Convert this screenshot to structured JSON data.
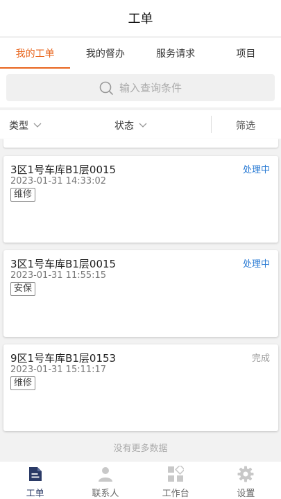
{
  "header": {
    "title": "工单"
  },
  "tabs": [
    {
      "label": "我的工单",
      "active": true
    },
    {
      "label": "我的督办",
      "active": false
    },
    {
      "label": "服务请求",
      "active": false
    },
    {
      "label": "项目",
      "active": false
    }
  ],
  "search": {
    "placeholder": "输入查询条件",
    "icon": "search-icon"
  },
  "filters": {
    "type_label": "类型",
    "status_label": "状态",
    "screen_label": "筛选"
  },
  "orders": [
    {
      "title": "3区1号车库B1层0015",
      "status": "处理中",
      "status_color": "#2a7bd4",
      "time": "2023-01-31 14:33:02",
      "tag": "维修"
    },
    {
      "title": "3区1号车库B1层0015",
      "status": "处理中",
      "status_color": "#2a7bd4",
      "time": "2023-01-31 11:55:15",
      "tag": "安保"
    },
    {
      "title": "9区1号车库B1层0153",
      "status": "完成",
      "status_color": "#999999",
      "time": "2023-01-31 15:11:17",
      "tag": "维修"
    }
  ],
  "list_footer": "没有更多数据",
  "tabbar": {
    "items": [
      {
        "label": "工单",
        "icon": "document-icon",
        "active": true
      },
      {
        "label": "联系人",
        "icon": "person-icon",
        "active": false
      },
      {
        "label": "工作台",
        "icon": "grid-icon",
        "active": false
      },
      {
        "label": "设置",
        "icon": "gear-icon",
        "active": false
      }
    ]
  },
  "colors": {
    "accent": "#e8641c",
    "tabbar_active": "#2a3a66",
    "tabbar_inactive": "#c8c8c8"
  }
}
